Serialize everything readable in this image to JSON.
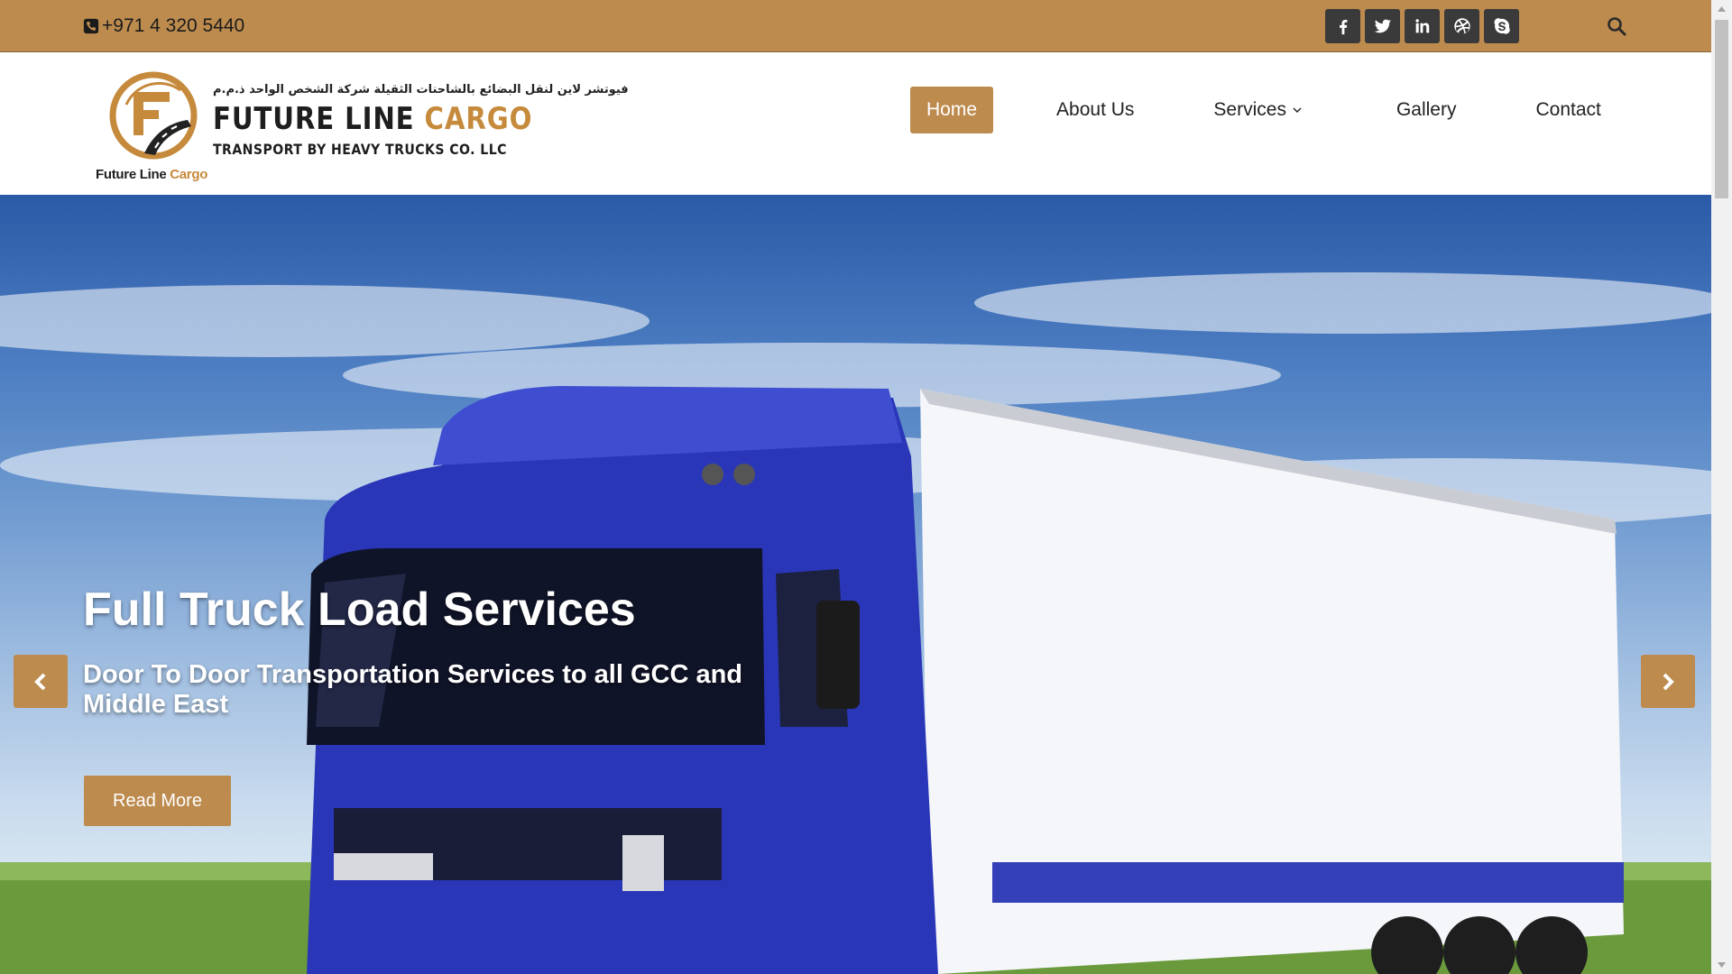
{
  "topbar": {
    "phone": "+971 4 320 5440",
    "social_icons": [
      "facebook-icon",
      "twitter-icon",
      "linkedin-icon",
      "dribbble-icon",
      "skype-icon"
    ],
    "search_icon": "search-icon"
  },
  "logo": {
    "arabic": "فيوتشر لاين لنقل البضائع بالشاحنات الثقيلة شركة الشخص الواحد ذ.م.م",
    "name_main": "FUTURE LINE ",
    "name_accent": "CARGO",
    "subtitle": "TRANSPORT BY HEAVY TRUCKS CO. LLC",
    "small_main": "Future Line ",
    "small_accent": "Cargo"
  },
  "nav": {
    "home": "Home",
    "about": "About Us",
    "services": "Services",
    "gallery": "Gallery",
    "contact": "Contact",
    "active": "Home"
  },
  "hero": {
    "title": "Full Truck Load Services",
    "subtitle": "Door To Door Transportation Services to all GCC and Middle East",
    "button": "Read More"
  },
  "colors": {
    "brand": "#bd8b4e",
    "dark": "#3a3a3a",
    "truck_blue": "#2a36b8"
  }
}
